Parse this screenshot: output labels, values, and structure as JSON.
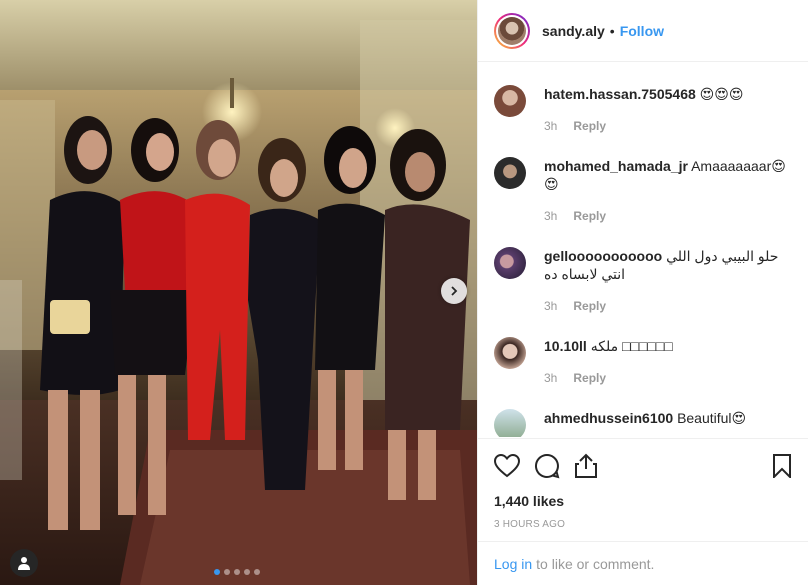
{
  "post": {
    "username": "sandy.aly",
    "separator": "•",
    "follow_label": "Follow",
    "likes": "1,440 likes",
    "time_ago": "3 HOURS AGO",
    "carousel_total": 5,
    "carousel_active": 0
  },
  "comments": [
    {
      "user": "hatem.hassan.7505468",
      "text": "😍😍😍",
      "time": "3h",
      "reply": "Reply",
      "avatar_color": "#7a4a3a"
    },
    {
      "user": "mohamed_hamada_jr",
      "text": "Amaaaaaaar😍 😍",
      "time": "3h",
      "reply": "Reply",
      "avatar_color": "#2b2b2b"
    },
    {
      "user": "gellooooooooooo",
      "text": "حلو البيبي دول اللي انتي لابساه ده",
      "time": "3h",
      "reply": "Reply",
      "avatar_color": "#5a3d6b"
    },
    {
      "user": "10.10ll",
      "text": "ملكه □□□□□□",
      "time": "3h",
      "reply": "Reply",
      "avatar_color": "#c9a999"
    },
    {
      "user": "ahmedhussein6100",
      "text": "Beautiful😍",
      "time": "",
      "reply": "",
      "avatar_color": "#a8c8d8"
    }
  ],
  "footer": {
    "login_link": "Log in",
    "login_rest": "to like or comment."
  },
  "icons": {
    "like": "heart-icon",
    "comment": "comment-icon",
    "share": "share-icon",
    "save": "bookmark-icon",
    "tag": "user-tag-icon",
    "next": "chevron-right-icon"
  },
  "colors": {
    "accent": "#3897f0",
    "muted": "#999999",
    "text": "#262626",
    "border": "#efefef"
  }
}
